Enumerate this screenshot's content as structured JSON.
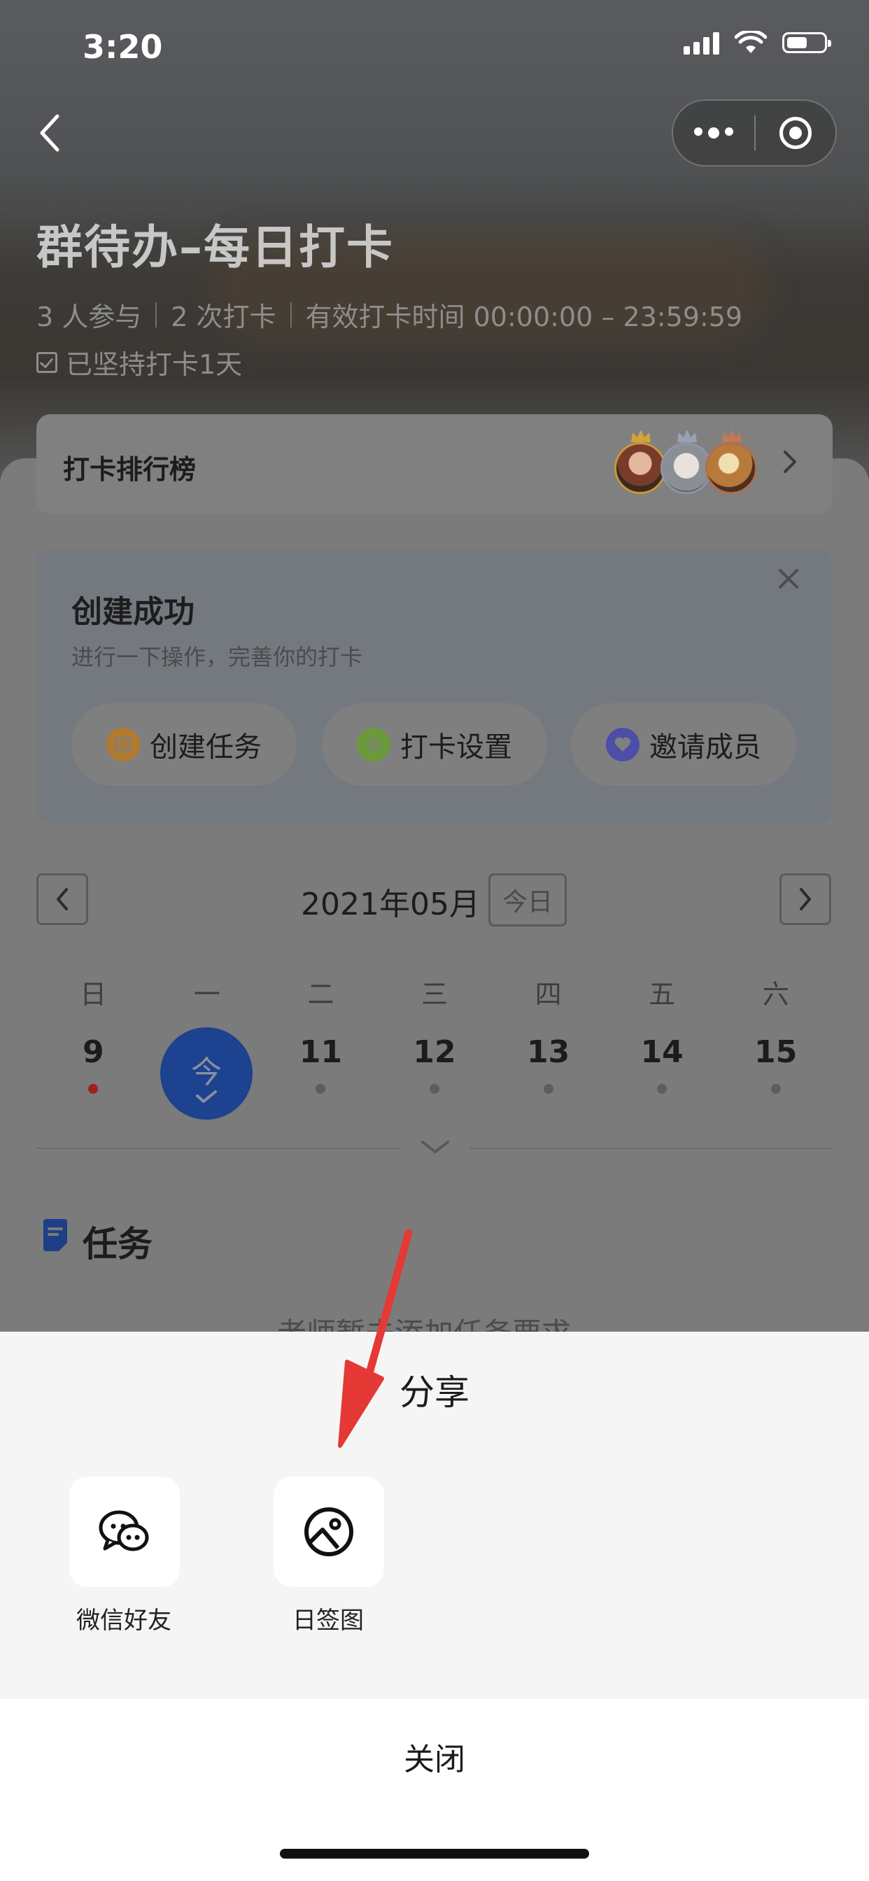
{
  "status_bar": {
    "time": "3:20"
  },
  "header": {
    "title": "群待办–每日打卡",
    "participants": "3 人参与",
    "checkins": "2 次打卡",
    "valid_time": "有效打卡时间 00:00:00 – 23:59:59",
    "persist": "已坚持打卡1天"
  },
  "ranking": {
    "label": "打卡排行榜"
  },
  "success_card": {
    "title": "创建成功",
    "subtitle": "进行一下操作，完善你的打卡",
    "actions": [
      {
        "label": "创建任务",
        "icon": "task-icon",
        "color": "#c8923a"
      },
      {
        "label": "打卡设置",
        "icon": "gear-icon",
        "color": "#7fa84a"
      },
      {
        "label": "邀请成员",
        "icon": "heart-icon",
        "color": "#5a5cc4"
      }
    ]
  },
  "calendar": {
    "month": "2021年05月",
    "today_button": "今日",
    "weekdays": [
      "日",
      "一",
      "二",
      "三",
      "四",
      "五",
      "六"
    ],
    "days": [
      "9",
      "今",
      "11",
      "12",
      "13",
      "14",
      "15"
    ]
  },
  "tasks": {
    "title": "任务",
    "empty_hint": "老师暂未添加任务要求"
  },
  "share_sheet": {
    "title": "分享",
    "options": [
      {
        "label": "微信好友",
        "icon": "wechat-icon"
      },
      {
        "label": "日签图",
        "icon": "image-icon"
      }
    ],
    "close": "关闭"
  },
  "colors": {
    "today": "#1c4290",
    "accent_red": "#e53935"
  }
}
